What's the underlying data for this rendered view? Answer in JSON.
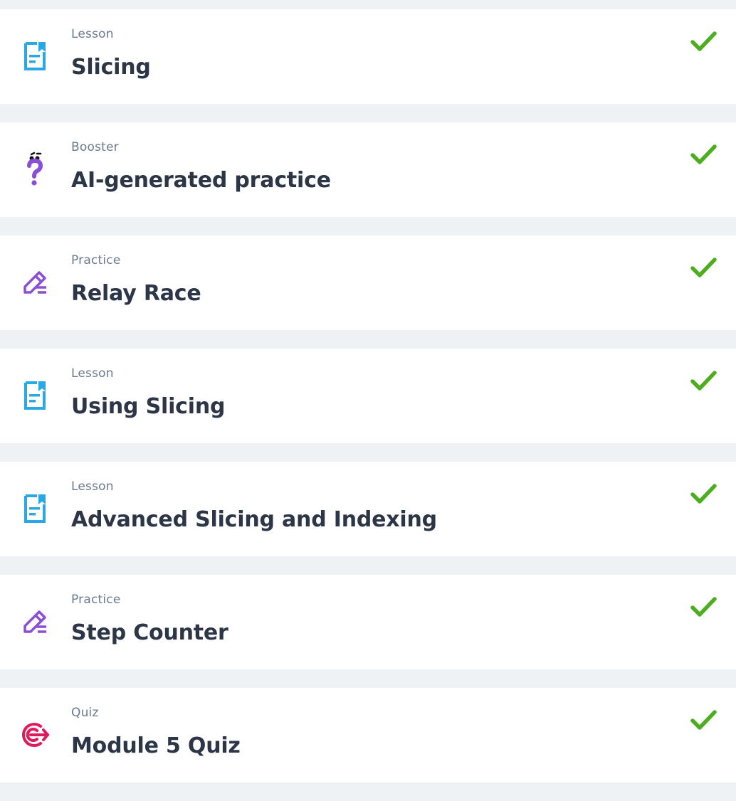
{
  "items": [
    {
      "kind": "Lesson",
      "title": "Slicing",
      "icon": "lesson-document-icon",
      "status": "completed"
    },
    {
      "kind": "Booster",
      "title": "AI-generated practice",
      "icon": "question-mark-icon",
      "status": "completed"
    },
    {
      "kind": "Practice",
      "title": "Relay Race",
      "icon": "pencil-icon",
      "status": "completed"
    },
    {
      "kind": "Lesson",
      "title": "Using Slicing",
      "icon": "lesson-document-icon",
      "status": "completed"
    },
    {
      "kind": "Lesson",
      "title": "Advanced Slicing and Indexing",
      "icon": "lesson-document-icon",
      "status": "completed"
    },
    {
      "kind": "Practice",
      "title": "Step Counter",
      "icon": "pencil-icon",
      "status": "completed"
    },
    {
      "kind": "Quiz",
      "title": "Module 5 Quiz",
      "icon": "target-icon",
      "status": "completed"
    }
  ],
  "colors": {
    "background": "#eff2f5",
    "card": "#ffffff",
    "kind_text": "#6b7a8d",
    "title_text": "#2c3647",
    "lesson_icon": "#29a8e8",
    "practice_icon": "#8a4fd6",
    "booster_icon": "#8a4fd6",
    "quiz_icon": "#e0195a",
    "check": "#4cae1f"
  }
}
